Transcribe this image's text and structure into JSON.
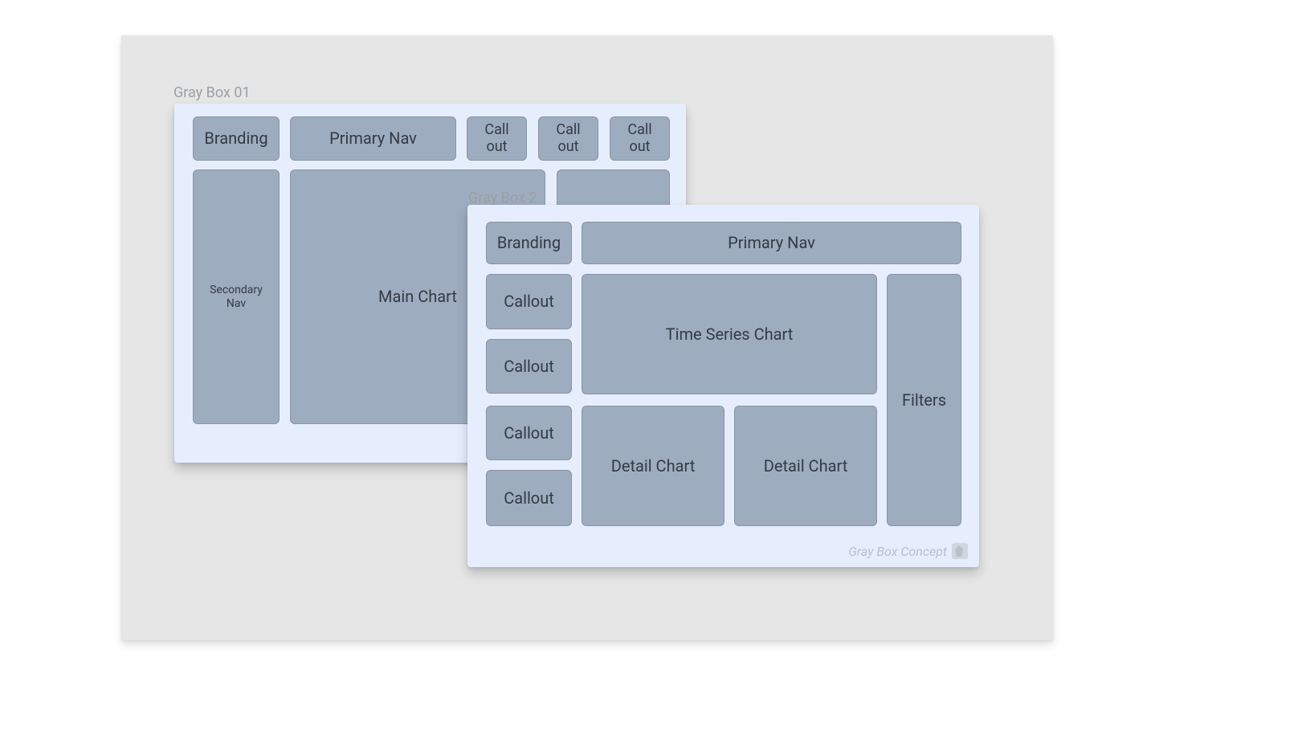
{
  "titles": {
    "wf1": "Gray Box 01",
    "wf2": "Gray Box 2"
  },
  "wf1": {
    "branding": "Branding",
    "primary_nav": "Primary Nav",
    "callout_a": "Call\nout",
    "callout_b": "Call\nout",
    "callout_c": "Call\nout",
    "secondary_nav": "Secondary\nNav",
    "main_chart": "Main Chart"
  },
  "wf2": {
    "branding": "Branding",
    "primary_nav": "Primary Nav",
    "callout_1": "Callout",
    "callout_2": "Callout",
    "callout_3": "Callout",
    "callout_4": "Callout",
    "time_series": "Time Series Chart",
    "detail_a": "Detail Chart",
    "detail_b": "Detail Chart",
    "filters": "Filters"
  },
  "footer": {
    "note": "Gray Box Concept"
  }
}
